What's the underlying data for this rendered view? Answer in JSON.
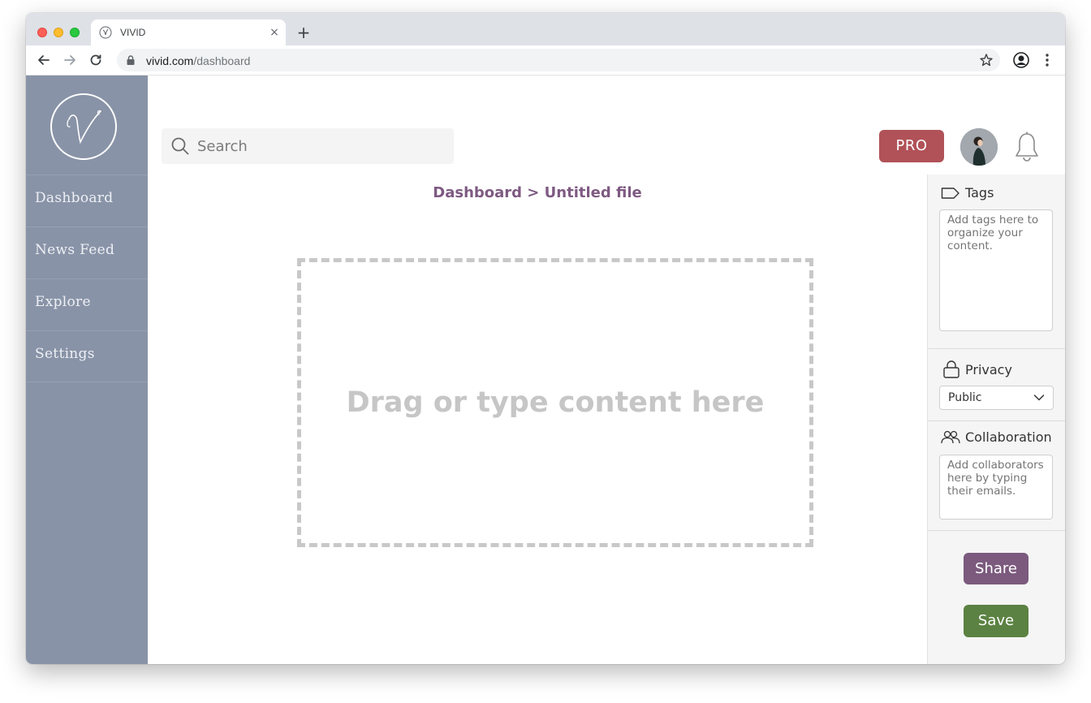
{
  "browser": {
    "tab_title": "VIVID",
    "url_host": "vivid.com",
    "url_path": "/dashboard",
    "new_tab_label": "+",
    "close_label": "×"
  },
  "sidebar": {
    "logo_letter": "V",
    "items": [
      {
        "label": "Dashboard"
      },
      {
        "label": "News Feed"
      },
      {
        "label": "Explore"
      },
      {
        "label": "Settings"
      }
    ]
  },
  "header": {
    "search_placeholder": "Search",
    "pro_label": "PRO"
  },
  "main": {
    "breadcrumb": "Dashboard > Untitled file",
    "dropzone_text": "Drag or type content here"
  },
  "panel": {
    "tags_label": "Tags",
    "tags_placeholder": "Add tags here to organize your content.",
    "privacy_label": "Privacy",
    "privacy_value": "Public",
    "privacy_options": [
      "Public"
    ],
    "collab_label": "Collaboration",
    "collab_placeholder": "Add collaborators here by typing their emails.",
    "share_label": "Share",
    "save_label": "Save"
  },
  "colors": {
    "sidebar_bg": "#8893a7",
    "pro": "#b05258",
    "share": "#7b5a7e",
    "save": "#5b8242",
    "breadcrumb": "#7e5a82"
  }
}
